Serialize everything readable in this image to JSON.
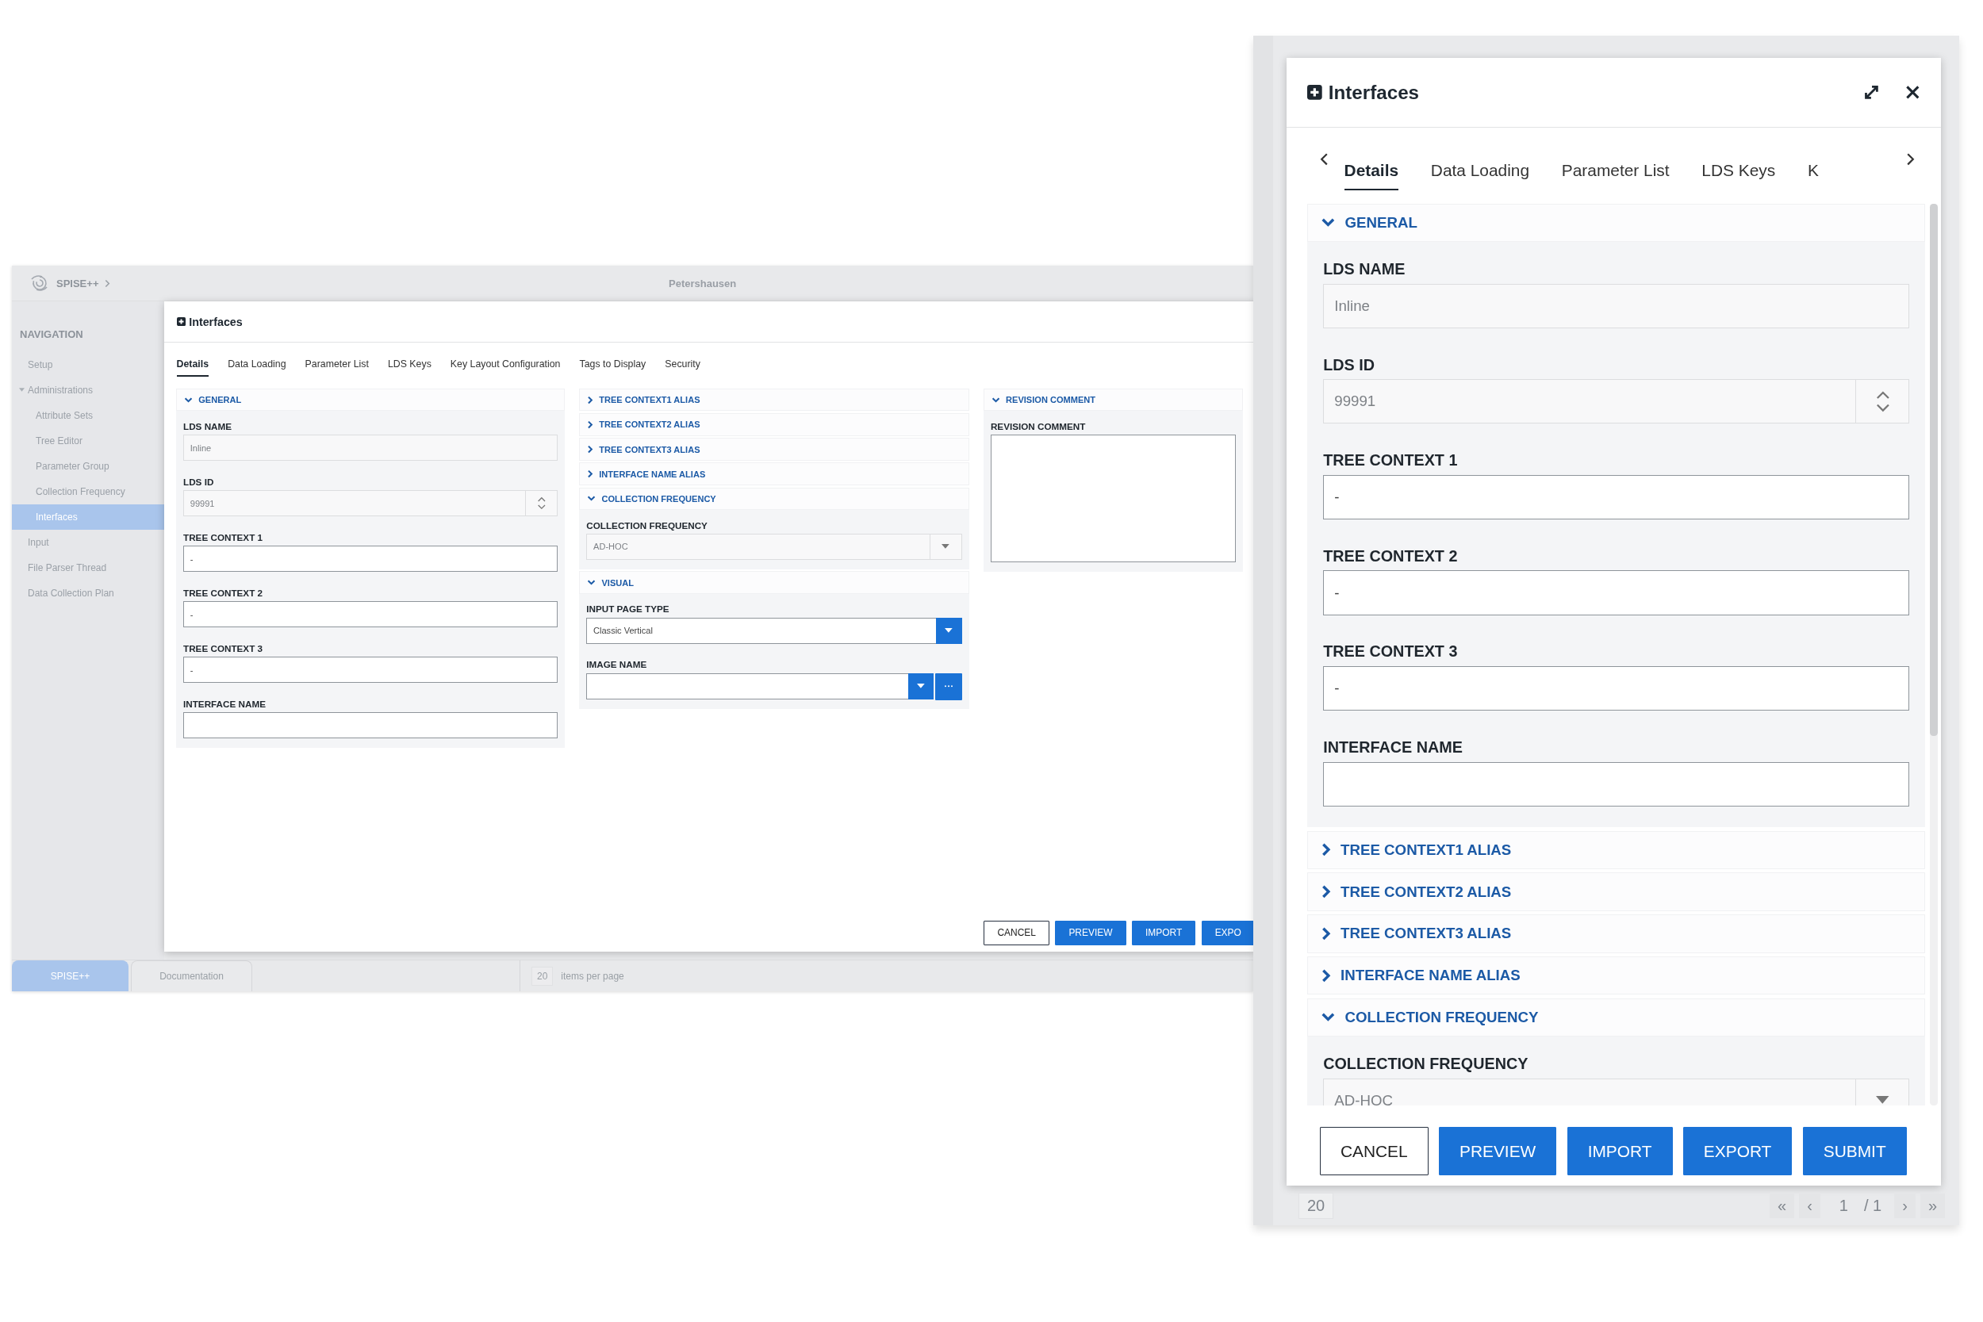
{
  "overview": {
    "app_name": "SPISE++",
    "location": "Petershausen",
    "navigation": {
      "title": "NAVIGATION",
      "items": [
        {
          "label": "Setup",
          "selected": false
        },
        {
          "label": "Administrations",
          "selected": false,
          "expanded": true,
          "children": [
            {
              "label": "Attribute Sets",
              "selected": false
            },
            {
              "label": "Tree Editor",
              "selected": false
            },
            {
              "label": "Parameter Group",
              "selected": false
            },
            {
              "label": "Collection Frequency",
              "selected": false
            },
            {
              "label": "Interfaces",
              "selected": true
            }
          ]
        },
        {
          "label": "Input",
          "selected": false
        },
        {
          "label": "File Parser Thread",
          "selected": false
        },
        {
          "label": "Data Collection Plan",
          "selected": false
        }
      ]
    },
    "dialog": {
      "title": "Interfaces",
      "tabs": [
        {
          "label": "Details",
          "selected": true
        },
        {
          "label": "Data Loading",
          "selected": false
        },
        {
          "label": "Parameter List",
          "selected": false
        },
        {
          "label": "LDS Keys",
          "selected": false
        },
        {
          "label": "Key Layout Configuration",
          "selected": false
        },
        {
          "label": "Tags to Display",
          "selected": false
        },
        {
          "label": "Security",
          "selected": false
        }
      ],
      "columns": [
        {
          "sections": [
            {
              "title": "GENERAL",
              "expanded": true,
              "fields": [
                {
                  "label": "LDS NAME",
                  "kind": "text",
                  "value": "Inline",
                  "disabled": true
                },
                {
                  "label": "LDS ID",
                  "kind": "number",
                  "value": "99991",
                  "disabled": true
                },
                {
                  "label": "TREE CONTEXT 1",
                  "kind": "text",
                  "value": "-",
                  "disabled": false
                },
                {
                  "label": "TREE CONTEXT 2",
                  "kind": "text",
                  "value": "-",
                  "disabled": false
                },
                {
                  "label": "TREE CONTEXT 3",
                  "kind": "text",
                  "value": "-",
                  "disabled": false
                },
                {
                  "label": "INTERFACE NAME",
                  "kind": "text",
                  "disabled": false
                }
              ]
            }
          ]
        },
        {
          "sections": [
            {
              "title": "TREE CONTEXT1 ALIAS",
              "expanded": false
            },
            {
              "title": "TREE CONTEXT2 ALIAS",
              "expanded": false
            },
            {
              "title": "TREE CONTEXT3 ALIAS",
              "expanded": false
            },
            {
              "title": "INTERFACE NAME ALIAS",
              "expanded": false
            },
            {
              "title": "COLLECTION FREQUENCY",
              "expanded": true,
              "fields": [
                {
                  "label": "COLLECTION FREQUENCY",
                  "kind": "select",
                  "value": "AD-HOC",
                  "disabled": true
                }
              ]
            },
            {
              "title": "VISUAL",
              "expanded": true,
              "fields": [
                {
                  "label": "INPUT PAGE TYPE",
                  "kind": "select_button",
                  "value": "Classic Vertical",
                  "disabled": false
                },
                {
                  "label": "IMAGE NAME",
                  "kind": "select_browse",
                  "disabled": false
                }
              ]
            }
          ]
        },
        {
          "sections": [
            {
              "title": "REVISION COMMENT",
              "expanded": true,
              "fields": [
                {
                  "label": "REVISION COMMENT",
                  "kind": "textarea",
                  "disabled": false
                }
              ]
            }
          ]
        }
      ],
      "buttons": [
        {
          "label": "CANCEL",
          "kind": "secondary"
        },
        {
          "label": "PREVIEW",
          "kind": "primary"
        },
        {
          "label": "IMPORT",
          "kind": "primary"
        },
        {
          "label": "EXPO",
          "kind": "primary"
        }
      ]
    },
    "footer": {
      "tabs": [
        {
          "label": "SPISE++",
          "selected": true
        },
        {
          "label": "Documentation",
          "selected": false
        }
      ],
      "page_size": "20",
      "page_size_label": "items per page"
    }
  },
  "detail": {
    "dialog": {
      "title": "Interfaces",
      "tabs": [
        {
          "label": "Details",
          "selected": true
        },
        {
          "label": "Data Loading",
          "selected": false
        },
        {
          "label": "Parameter List",
          "selected": false
        },
        {
          "label": "LDS Keys",
          "selected": false
        },
        {
          "label": "K",
          "selected": false
        }
      ],
      "sections": [
        {
          "title": "GENERAL",
          "expanded": true,
          "fields": [
            {
              "label": "LDS NAME",
              "kind": "text",
              "value": "Inline",
              "disabled": true
            },
            {
              "label": "LDS ID",
              "kind": "number",
              "value": "99991",
              "disabled": true
            },
            {
              "label": "TREE CONTEXT 1",
              "kind": "text",
              "value": "-",
              "disabled": false
            },
            {
              "label": "TREE CONTEXT 2",
              "kind": "text",
              "value": "-",
              "disabled": false
            },
            {
              "label": "TREE CONTEXT 3",
              "kind": "text",
              "value": "-",
              "disabled": false
            },
            {
              "label": "INTERFACE NAME",
              "kind": "text",
              "disabled": false
            }
          ]
        },
        {
          "title": "TREE CONTEXT1 ALIAS",
          "expanded": false
        },
        {
          "title": "TREE CONTEXT2 ALIAS",
          "expanded": false
        },
        {
          "title": "TREE CONTEXT3 ALIAS",
          "expanded": false
        },
        {
          "title": "INTERFACE NAME ALIAS",
          "expanded": false
        },
        {
          "title": "COLLECTION FREQUENCY",
          "expanded": true,
          "fields": [
            {
              "label": "COLLECTION FREQUENCY",
              "kind": "select",
              "value": "AD-HOC",
              "disabled": true
            }
          ]
        }
      ],
      "buttons": [
        {
          "label": "CANCEL",
          "kind": "secondary"
        },
        {
          "label": "PREVIEW",
          "kind": "primary"
        },
        {
          "label": "IMPORT",
          "kind": "primary"
        },
        {
          "label": "EXPORT",
          "kind": "primary"
        },
        {
          "label": "SUBMIT",
          "kind": "primary"
        }
      ]
    },
    "pager": {
      "page_size": "20",
      "first": "«",
      "previous": "‹",
      "page": "1",
      "total": "/ 1",
      "next": "›",
      "last": "»"
    }
  }
}
